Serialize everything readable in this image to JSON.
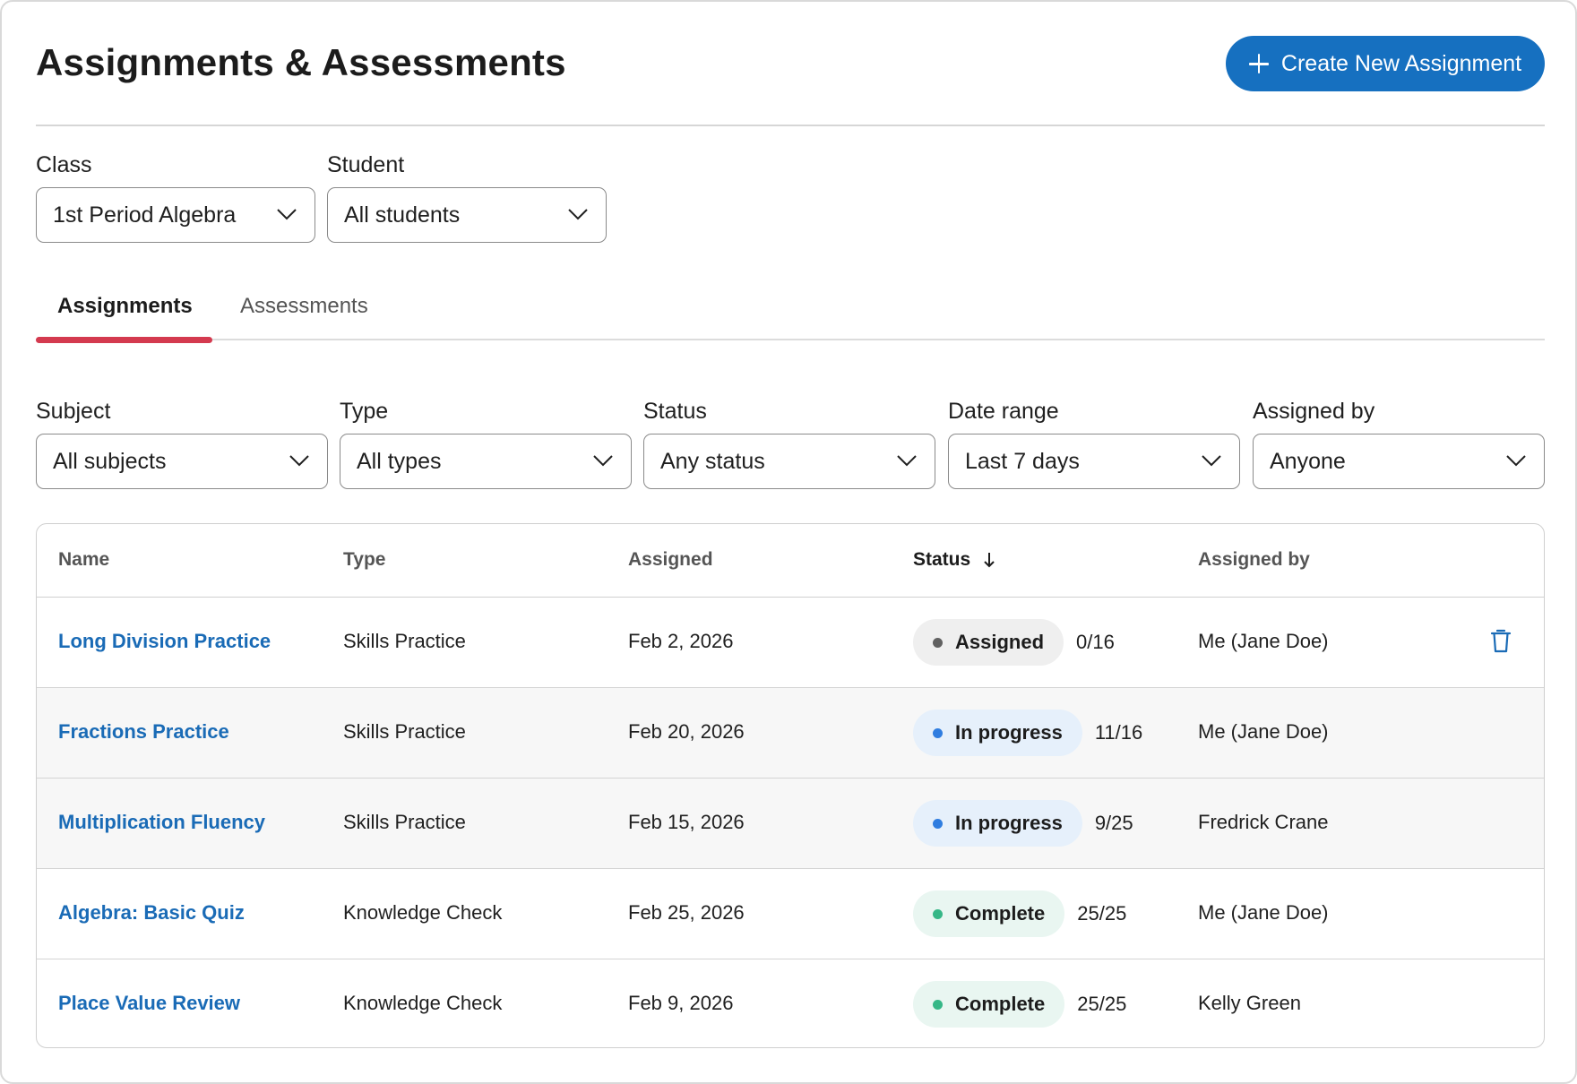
{
  "header": {
    "title": "Assignments & Assessments",
    "create_button_label": "Create New Assignment"
  },
  "top_filters": {
    "class": {
      "label": "Class",
      "value": "1st Period Algebra"
    },
    "student": {
      "label": "Student",
      "value": "All students"
    }
  },
  "tabs": [
    {
      "label": "Assignments",
      "active": true
    },
    {
      "label": "Assessments",
      "active": false
    }
  ],
  "filters": [
    {
      "label": "Subject",
      "value": "All subjects"
    },
    {
      "label": "Type",
      "value": "All types"
    },
    {
      "label": "Status",
      "value": "Any status"
    },
    {
      "label": "Date range",
      "value": "Last 7 days"
    },
    {
      "label": "Assigned by",
      "value": "Anyone"
    }
  ],
  "table": {
    "columns": [
      "Name",
      "Type",
      "Assigned",
      "Status",
      "Assigned by"
    ],
    "sorted_column": "Status",
    "sort_direction": "descending",
    "rows": [
      {
        "name": "Long Division Practice",
        "type": "Skills Practice",
        "assigned": "Feb 2, 2026",
        "status": "Assigned",
        "progress": "0/16",
        "assigned_by": "Me (Jane Doe)",
        "deletable": true
      },
      {
        "name": "Fractions Practice",
        "type": "Skills Practice",
        "assigned": "Feb 20, 2026",
        "status": "In progress",
        "progress": "11/16",
        "assigned_by": "Me (Jane Doe)",
        "deletable": false
      },
      {
        "name": "Multiplication Fluency",
        "type": "Skills Practice",
        "assigned": "Feb 15, 2026",
        "status": "In progress",
        "progress": "9/25",
        "assigned_by": "Fredrick Crane",
        "deletable": false
      },
      {
        "name": "Algebra: Basic Quiz",
        "type": "Knowledge Check",
        "assigned": "Feb 25, 2026",
        "status": "Complete",
        "progress": "25/25",
        "assigned_by": "Me (Jane Doe)",
        "deletable": false
      },
      {
        "name": "Place Value Review",
        "type": "Knowledge Check",
        "assigned": "Feb 9, 2026",
        "status": "Complete",
        "progress": "25/25",
        "assigned_by": "Kelly Green",
        "deletable": false
      }
    ]
  },
  "colors": {
    "primary": "#1670c0",
    "link": "#1a6bb6",
    "tab_accent": "#d43a4f",
    "status_assigned": "#616161",
    "status_in_progress": "#2f7de0",
    "status_complete": "#36b787"
  },
  "icons": {
    "create": "plus-icon",
    "dropdown": "chevron-down-icon",
    "sort": "arrow-down-icon",
    "delete": "trash-icon"
  }
}
